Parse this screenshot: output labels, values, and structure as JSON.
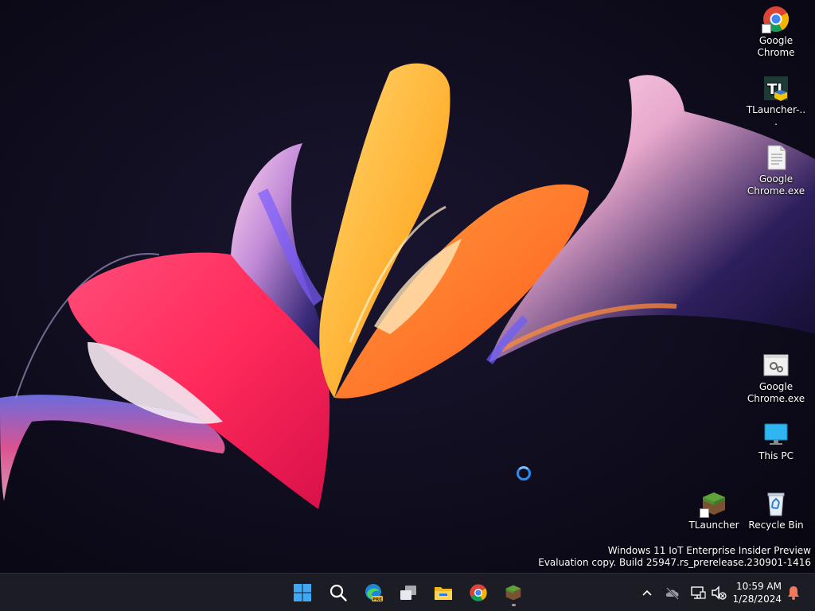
{
  "desktop": {
    "icons": [
      {
        "label": "Google Chrome",
        "icon": "chrome-icon"
      },
      {
        "label": "TLauncher-...",
        "icon": "tlauncher-installer-icon"
      },
      {
        "label": "Google Chrome.exe",
        "icon": "document-icon"
      },
      {
        "label": "Google Chrome.exe",
        "icon": "settings-file-icon"
      },
      {
        "label": "This PC",
        "icon": "monitor-icon"
      },
      {
        "label": "TLauncher",
        "icon": "grass-block-icon"
      },
      {
        "label": "Recycle Bin",
        "icon": "recycle-bin-icon"
      }
    ],
    "watermark": {
      "line1": "Windows 11 IoT Enterprise Insider Preview",
      "line2": "Evaluation copy. Build 25947.rs_prerelease.230901-1416"
    }
  },
  "taskbar": {
    "pinned": [
      "start",
      "search",
      "edge-preview",
      "task-view",
      "file-explorer",
      "chrome",
      "minecraft"
    ],
    "clock": {
      "time": "10:59 AM",
      "date": "1/28/2024"
    }
  },
  "colors": {
    "taskbar": "#1c1c24",
    "accent": "#2a8ef0",
    "background": "#0b0a18"
  }
}
